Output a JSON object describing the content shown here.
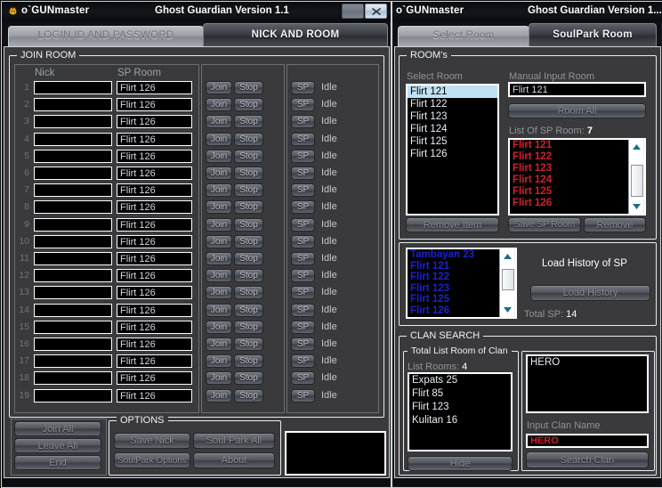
{
  "left_window": {
    "title_app": "o`GUNmaster",
    "title_version": "Ghost Guardian Version 1.1",
    "close_label": "x",
    "tabs": [
      {
        "label": "LOGIN ID AND PASSWORD",
        "active": false
      },
      {
        "label": "NICK AND ROOM",
        "active": true
      }
    ],
    "join_room": {
      "group_title": "JOIN ROOM",
      "col_nick": "Nick",
      "col_sp_room": "SP Room",
      "rows": [
        {
          "n": "1",
          "nick": "",
          "sp_room": "Flirt 126",
          "join": "Join",
          "stop": "Stop",
          "sp": "SP",
          "status": "Idle"
        },
        {
          "n": "2",
          "nick": "",
          "sp_room": "Flirt 126",
          "join": "Join",
          "stop": "Stop",
          "sp": "SP",
          "status": "Idle"
        },
        {
          "n": "3",
          "nick": "",
          "sp_room": "Flirt 126",
          "join": "Join",
          "stop": "Stop",
          "sp": "SP",
          "status": "Idle"
        },
        {
          "n": "4",
          "nick": "",
          "sp_room": "Flirt 126",
          "join": "Join",
          "stop": "Stop",
          "sp": "SP",
          "status": "Idle"
        },
        {
          "n": "5",
          "nick": "",
          "sp_room": "Flirt 126",
          "join": "Join",
          "stop": "Stop",
          "sp": "SP",
          "status": "Idle"
        },
        {
          "n": "6",
          "nick": "",
          "sp_room": "Flirt 126",
          "join": "Join",
          "stop": "Stop",
          "sp": "SP",
          "status": "Idle"
        },
        {
          "n": "7",
          "nick": "",
          "sp_room": "Flirt 126",
          "join": "Join",
          "stop": "Stop",
          "sp": "SP",
          "status": "Idle"
        },
        {
          "n": "8",
          "nick": "",
          "sp_room": "Flirt 126",
          "join": "Join",
          "stop": "Stop",
          "sp": "SP",
          "status": "Idle"
        },
        {
          "n": "9",
          "nick": "",
          "sp_room": "Flirt 126",
          "join": "Join",
          "stop": "Stop",
          "sp": "SP",
          "status": "Idle"
        },
        {
          "n": "10",
          "nick": "",
          "sp_room": "Flirt 126",
          "join": "Join",
          "stop": "Stop",
          "sp": "SP",
          "status": "Idle"
        },
        {
          "n": "11",
          "nick": "",
          "sp_room": "Flirt 126",
          "join": "Join",
          "stop": "Stop",
          "sp": "SP",
          "status": "Idle"
        },
        {
          "n": "12",
          "nick": "",
          "sp_room": "Flirt 126",
          "join": "Join",
          "stop": "Stop",
          "sp": "SP",
          "status": "Idle"
        },
        {
          "n": "13",
          "nick": "",
          "sp_room": "Flirt 126",
          "join": "Join",
          "stop": "Stop",
          "sp": "SP",
          "status": "Idle"
        },
        {
          "n": "14",
          "nick": "",
          "sp_room": "Flirt 126",
          "join": "Join",
          "stop": "Stop",
          "sp": "SP",
          "status": "Idle"
        },
        {
          "n": "15",
          "nick": "",
          "sp_room": "Flirt 126",
          "join": "Join",
          "stop": "Stop",
          "sp": "SP",
          "status": "Idle"
        },
        {
          "n": "16",
          "nick": "",
          "sp_room": "Flirt 126",
          "join": "Join",
          "stop": "Stop",
          "sp": "SP",
          "status": "Idle"
        },
        {
          "n": "17",
          "nick": "",
          "sp_room": "Flirt 126",
          "join": "Join",
          "stop": "Stop",
          "sp": "SP",
          "status": "Idle"
        },
        {
          "n": "18",
          "nick": "",
          "sp_room": "Flirt 126",
          "join": "Join",
          "stop": "Stop",
          "sp": "SP",
          "status": "Idle"
        },
        {
          "n": "19",
          "nick": "",
          "sp_room": "Flirt 126",
          "join": "Join",
          "stop": "Stop",
          "sp": "SP",
          "status": "Idle"
        }
      ]
    },
    "actions": {
      "join_all": "Join All",
      "leave_all": "Leave All",
      "end": "End"
    },
    "options": {
      "group_title": "OPTIONS",
      "save_nick": "Save Nick",
      "soul_park_all": "Soul Park All",
      "soulpark_options": "SoulPark Options",
      "about": "About"
    }
  },
  "right_window": {
    "title_app": "o`GUNmaster",
    "title_version": "Ghost Guardian Version 1...",
    "tabs": [
      {
        "label": "Select Room",
        "active": false
      },
      {
        "label": "SoulPark Room",
        "active": true
      }
    ],
    "rooms": {
      "group_title": "ROOM's",
      "select_room_label": "Select Room",
      "select_room_items": [
        "Flirt 121",
        "Flirt 122",
        "Flirt 123",
        "Flirt 124",
        "Flirt 125",
        "Flirt 126"
      ],
      "select_room_selected": "Flirt 121",
      "manual_input_label": "Manual Input Room",
      "manual_input_value": "Flirt 121",
      "room_all_button": "Room All",
      "list_of_sp_label": "List Of SP Room:",
      "list_of_sp_count": "7",
      "list_of_sp_items": [
        "Flirt 121",
        "Flirt 122",
        "Flirt 123",
        "Flirt 124",
        "Flirt 125",
        "Flirt 126"
      ],
      "remove_item_button": "Remove Item",
      "save_sp_room_button": "Save SP Room",
      "remove_button": "Remove"
    },
    "history": {
      "items": [
        "Tambayan 23",
        "Flirt 121",
        "Flirt 122",
        "Flirt 123",
        "Flirt 125",
        "Flirt 126"
      ],
      "title": "Load History of SP",
      "load_button": "Load History",
      "total_sp_label": "Total SP:",
      "total_sp_value": "14"
    },
    "clan_search": {
      "group_title": "CLAN SEARCH",
      "total_list_title": "Total List Room of Clan",
      "list_rooms_label": "List Rooms:",
      "list_rooms_count": "4",
      "list_rooms_items": [
        "Expats 25",
        "Flirt 85",
        "Flirt 123",
        "Kulitan 16"
      ],
      "hide_button": "Hide",
      "result_items": [
        "HERO"
      ],
      "input_clan_label": "Input Clan Name",
      "input_clan_value": "HERO",
      "search_button": "Search Clan"
    }
  },
  "colors": {
    "panel_bg": "#3a3a3c",
    "field_bg": "#000000",
    "field_border": "#ffffff",
    "sp_list_text": "#d0202a",
    "history_text": "#1b22c8",
    "clan_input_text": "#d0202a",
    "selection_bg": "#bfe0f5",
    "tab_active": "#3b3e43"
  }
}
